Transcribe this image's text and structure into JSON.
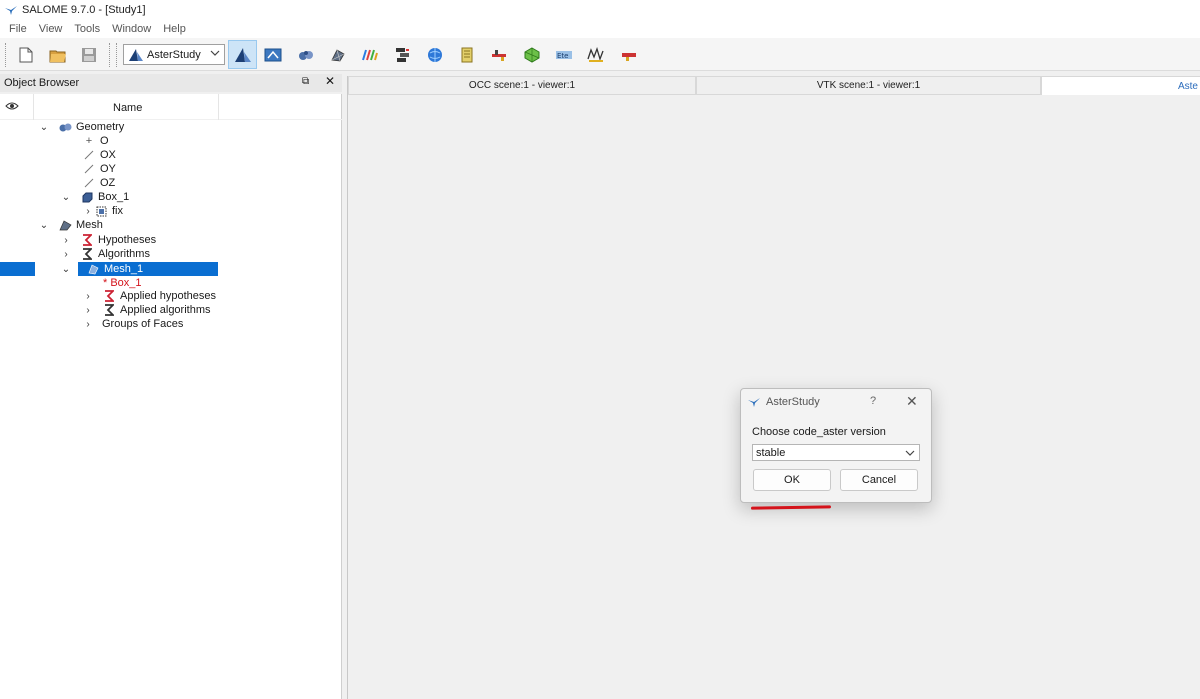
{
  "window": {
    "title": "SALOME 9.7.0 - [Study1]"
  },
  "menu": [
    "File",
    "View",
    "Tools",
    "Window",
    "Help"
  ],
  "toolbar": {
    "module_selector": "AsterStudy",
    "buttons": [
      "new-document-icon",
      "open-folder-icon",
      "save-icon",
      "asterstudy-icon",
      "shaper-icon",
      "geometry-icon",
      "mesh-icon",
      "paravis-icon",
      "yacs-icon",
      "jobmanager-icon",
      "notebook-icon",
      "homard-icon",
      "smesh-tool-icon",
      "fields-icon",
      "hexablock-icon",
      "pipe-icon"
    ]
  },
  "object_browser": {
    "title": "Object Browser",
    "column_name": "Name",
    "tree": {
      "geometry": "Geometry",
      "o": "O",
      "ox": "OX",
      "oy": "OY",
      "oz": "OZ",
      "box1": "Box_1",
      "fix": "fix",
      "mesh": "Mesh",
      "hypotheses": "Hypotheses",
      "algorithms": "Algorithms",
      "mesh1": "Mesh_1",
      "mesh1_box": "* Box_1",
      "applied_hypotheses": "Applied hypotheses",
      "applied_algorithms": "Applied algorithms",
      "groups_of_faces": "Groups of Faces"
    }
  },
  "viewer_tabs": [
    "OCC scene:1 - viewer:1",
    "VTK scene:1 - viewer:1",
    "Aste"
  ],
  "dialog": {
    "title": "AsterStudy",
    "help": "?",
    "label": "Choose code_aster version",
    "selected_version": "stable",
    "ok": "OK",
    "cancel": "Cancel"
  },
  "colors": {
    "selection": "#0a6ed1",
    "annotation_red": "#d4131b",
    "link_blue": "#2b6cbc"
  }
}
